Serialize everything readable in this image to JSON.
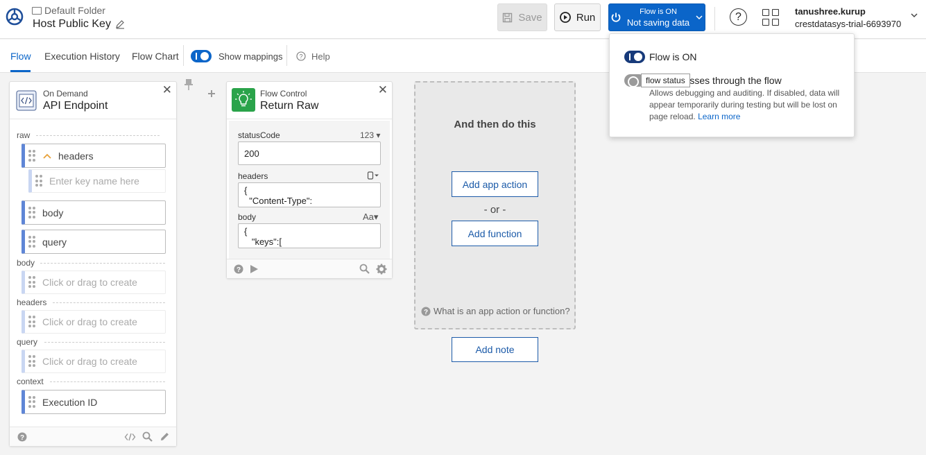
{
  "header": {
    "folder": "Default Folder",
    "title": "Host Public Key",
    "save_label": "Save",
    "run_label": "Run",
    "flow_status_line1": "Flow is ON",
    "flow_status_line2": "Not saving data",
    "help_glyph": "?",
    "user_name": "tanushree.kurup",
    "user_org": "crestdatasys-trial-6693970"
  },
  "tabs": {
    "flow": "Flow",
    "execution_history": "Execution History",
    "flow_chart": "Flow Chart",
    "show_mappings": "Show mappings",
    "help": "Help"
  },
  "trigger_card": {
    "kind": "On Demand",
    "name": "API Endpoint",
    "sections": {
      "raw": "raw",
      "body": "body",
      "headers": "headers",
      "query": "query",
      "context": "context"
    },
    "raw_fields": {
      "headers": "headers",
      "key_placeholder": "Enter key name here",
      "body": "body",
      "query": "query"
    },
    "create_placeholder": "Click or drag to create",
    "execution_id": "Execution ID"
  },
  "return_card": {
    "kind": "Flow Control",
    "name": "Return Raw",
    "status_code_label": "statusCode",
    "status_code_type": "123",
    "status_code_value": "200",
    "headers_label": "headers",
    "headers_value": "{\n  \"Content-Type\":",
    "body_label": "body",
    "body_type": "Aa",
    "body_value": "{\n   \"keys\":["
  },
  "dropzone": {
    "title": "And then do this",
    "add_app_action": "Add app action",
    "or_label": "- or -",
    "add_function": "Add function",
    "help_text": "What is an app action or function?"
  },
  "add_note": "Add note",
  "popover": {
    "flow_on": "Flow is ON",
    "save_data_label": "ta that passes through the flow",
    "description": "Allows debugging and auditing. If disabled, data will appear temporarily during testing but will be lost on page reload.",
    "learn_more": "Learn more",
    "tooltip": "flow status"
  },
  "colors": {
    "accent": "#0b65c9",
    "field_border": "#5f86d6",
    "trigger_icon_bg": "#2aa34a"
  }
}
